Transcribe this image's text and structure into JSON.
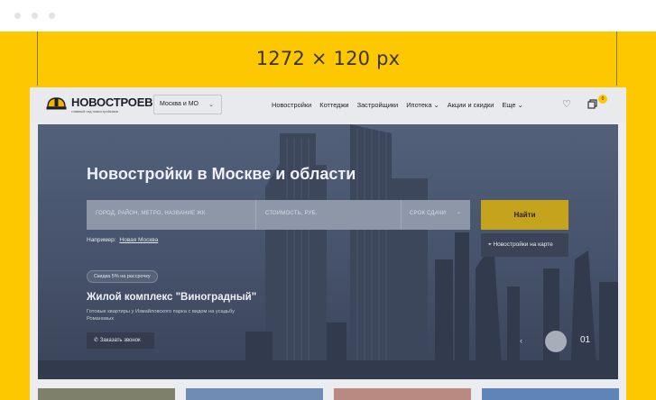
{
  "banner": {
    "dimension_label": "1272 × 120 px"
  },
  "colors": {
    "banner_bg": "#fdc800",
    "accent": "#c6a31c",
    "overlay": "#46526b"
  },
  "header": {
    "logo_name": "НОВОСТРОЕВ",
    "logo_tagline": "главный гид новостройками",
    "city_select": "Москва и МО",
    "nav": [
      {
        "label": "Новостройки"
      },
      {
        "label": "Коттеджи"
      },
      {
        "label": "Застройщики"
      },
      {
        "label": "Ипотека ⌄"
      },
      {
        "label": "Акции и скидки"
      },
      {
        "label": "Еще ⌄"
      }
    ],
    "cart_count": "0"
  },
  "hero": {
    "title": "Новостройки в Москве и области",
    "search": {
      "location_placeholder": "ГОРОД, РАЙОН, МЕТРО, НАЗВАНИЕ ЖК",
      "price_placeholder": "СТОИМОСТЬ, РУБ.",
      "deadline_placeholder": "СРОК СДАЧИ"
    },
    "find_button": "Найти",
    "map_button": "Новостройки на карте",
    "example_prefix": "Например:",
    "example_link": "Новая Москва",
    "promo_badge": "Скидка 5% на рассрочку",
    "complex_title": "Жилой комплекс \"Виноградный\"",
    "complex_desc": "Готовые квартиры у Измайловского парка с видом на усадьбу Романовых",
    "call_button": "Заказать звонок",
    "slide_number": "01"
  }
}
